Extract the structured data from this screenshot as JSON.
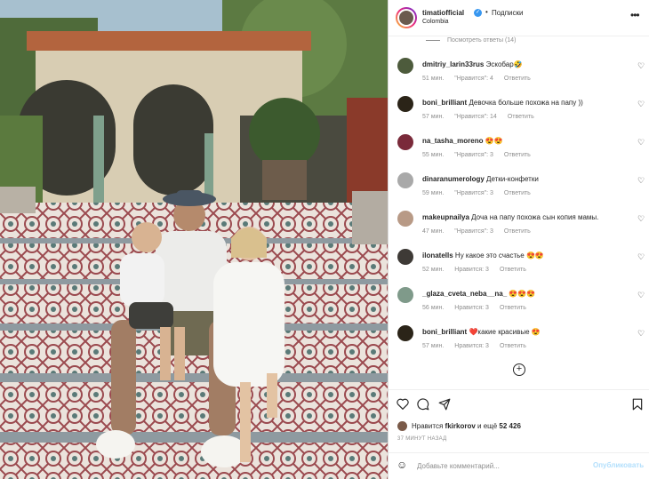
{
  "header": {
    "username": "timatiofficial",
    "separator": "•",
    "follow_label": "Подписки",
    "location": "Colombia",
    "more_icon": "more-horizontal-icon"
  },
  "replies_label": "Посмотреть ответы (14)",
  "comments": [
    {
      "user": "dmitriy_larin33rus",
      "text": "Эскобар🤣",
      "time": "51 мин.",
      "likes": "\"Нравится\": 4",
      "reply": "Ответить",
      "avatar_color": "#4d5b3c"
    },
    {
      "user": "boni_brilliant",
      "text": "Девочка больше похожа на папу ))",
      "time": "57 мин.",
      "likes": "\"Нравится\": 14",
      "reply": "Ответить",
      "avatar_color": "#2b2418"
    },
    {
      "user": "na_tasha_moreno",
      "text": "😍😍",
      "time": "55 мин.",
      "likes": "\"Нравится\": 3",
      "reply": "Ответить",
      "avatar_color": "#7a2a3a"
    },
    {
      "user": "dinaranumerology",
      "text": "Детки-конфетки",
      "time": "59 мин.",
      "likes": "\"Нравится\": 3",
      "reply": "Ответить",
      "avatar_color": "#a9a9a9"
    },
    {
      "user": "makeupnailya",
      "text": "Доча на папу похожа сын копия мамы.",
      "time": "47 мин.",
      "likes": "\"Нравится\": 3",
      "reply": "Ответить",
      "avatar_color": "#b89a86"
    },
    {
      "user": "ilonatells",
      "text": "Ну какое это счастье 😍😍",
      "time": "52 мин.",
      "likes": "Нравится: 3",
      "reply": "Ответить",
      "avatar_color": "#3e3a36"
    },
    {
      "user": "_glaza_cveta_neba__na_",
      "text": "😍😍😍",
      "time": "56 мин.",
      "likes": "Нравится: 3",
      "reply": "Ответить",
      "avatar_color": "#7f9a8a"
    },
    {
      "user": "boni_brilliant",
      "text": "❤️какие красивые 😍",
      "time": "57 мин.",
      "likes": "Нравится: 3",
      "reply": "Ответить",
      "avatar_color": "#2b2418"
    }
  ],
  "load_more_icon": "plus-circle-icon",
  "actions": {
    "like_icon": "heart-icon",
    "comment_icon": "comment-icon",
    "share_icon": "share-icon",
    "save_icon": "bookmark-icon"
  },
  "likes": {
    "prefix": "Нравится",
    "user": "fkirkorov",
    "suffix": "и ещё",
    "count": "52 426"
  },
  "post_time": "37 МИНУТ НАЗАД",
  "add_comment": {
    "placeholder": "Добавьте комментарий...",
    "publish_label": "Опубликовать",
    "emoji_icon": "smile-icon"
  },
  "colors": {
    "accent": "#3897f0",
    "publish_disabled": "#b2dffc",
    "secondary_text": "#8e8e8e"
  }
}
